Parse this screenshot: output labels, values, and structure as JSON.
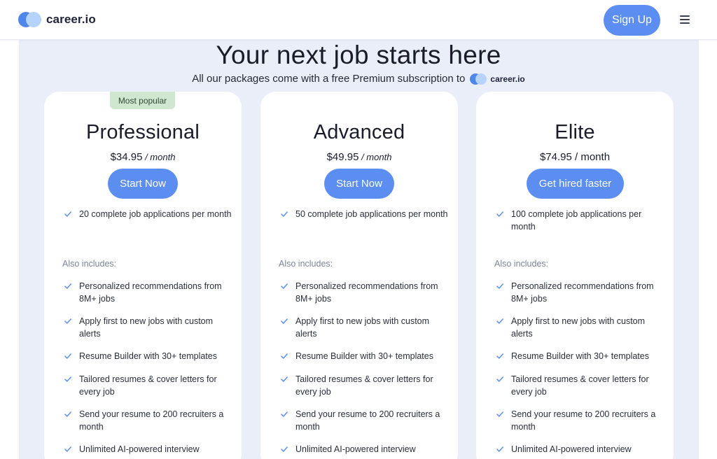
{
  "header": {
    "brand": "career.io",
    "signup_label": "Sign Up",
    "menu_icon": "hamburger-menu-icon"
  },
  "hero": {
    "title": "Your next job starts here",
    "subtitle": "All our packages come with a free Premium subscription to",
    "subtitle_brand": "career.io"
  },
  "colors": {
    "accent": "#5b8ef0",
    "background": "#e9eef8",
    "badge": "#cfe6cf",
    "check": "#5b8ef0"
  },
  "plans": [
    {
      "badge": "Most popular",
      "name": "Professional",
      "price": "$34.95",
      "period": " / month",
      "cta": "Start Now",
      "primary_feature": "20 complete job applications per month",
      "also_includes": "Also includes:",
      "features": [
        "Personalized recommendations from 8M+ jobs",
        "Apply first to new jobs with custom alerts",
        "Resume Builder with 30+ templates",
        "Tailored resumes & cover letters for every job",
        "Send your resume to 200 recruiters a month",
        "Unlimited AI-powered interview"
      ]
    },
    {
      "name": "Advanced",
      "price": "$49.95",
      "period": " / month",
      "cta": "Start Now",
      "primary_feature": "50 complete job applications per month",
      "also_includes": "Also includes:",
      "features": [
        "Personalized recommendations from 8M+ jobs",
        "Apply first to new jobs with custom alerts",
        "Resume Builder with 30+ templates",
        "Tailored resumes & cover letters for every job",
        "Send your resume to 200 recruiters a month",
        "Unlimited AI-powered interview"
      ]
    },
    {
      "name": "Elite",
      "price": "$74.95",
      "period": " / month",
      "cta": "Get hired faster",
      "primary_feature": "100 complete job applications per month",
      "also_includes": "Also includes:",
      "features": [
        "Personalized recommendations from 8M+ jobs",
        "Apply first to new jobs with custom alerts",
        "Resume Builder with 30+ templates",
        "Tailored resumes & cover letters for every job",
        "Send your resume to 200 recruiters a month",
        "Unlimited AI-powered interview"
      ]
    }
  ]
}
